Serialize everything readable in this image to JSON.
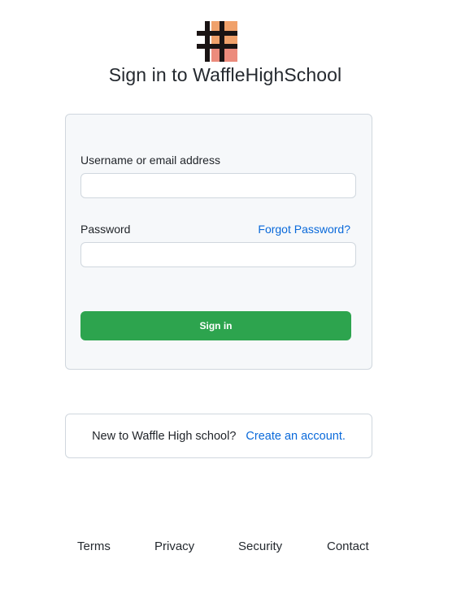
{
  "header": {
    "logo_icon": "waffle-grid-logo-icon",
    "title": "Sign in to WaffleHighSchool"
  },
  "login_form": {
    "username_label": "Username or email address",
    "username_value": "",
    "password_label": "Password",
    "password_value": "",
    "forgot_password_link": "Forgot Password?",
    "signin_button": "Sign in"
  },
  "create_account": {
    "prompt": "New to Waffle High school?",
    "link": "Create an account."
  },
  "footer": {
    "terms": "Terms",
    "privacy": "Privacy",
    "security": "Security",
    "contact": "Contact"
  },
  "colors": {
    "accent_green": "#2da44e",
    "link_blue": "#0969da",
    "logo_orange": "#f0a16b",
    "logo_pink": "#ec8b7c",
    "logo_dark": "#1a1414"
  }
}
